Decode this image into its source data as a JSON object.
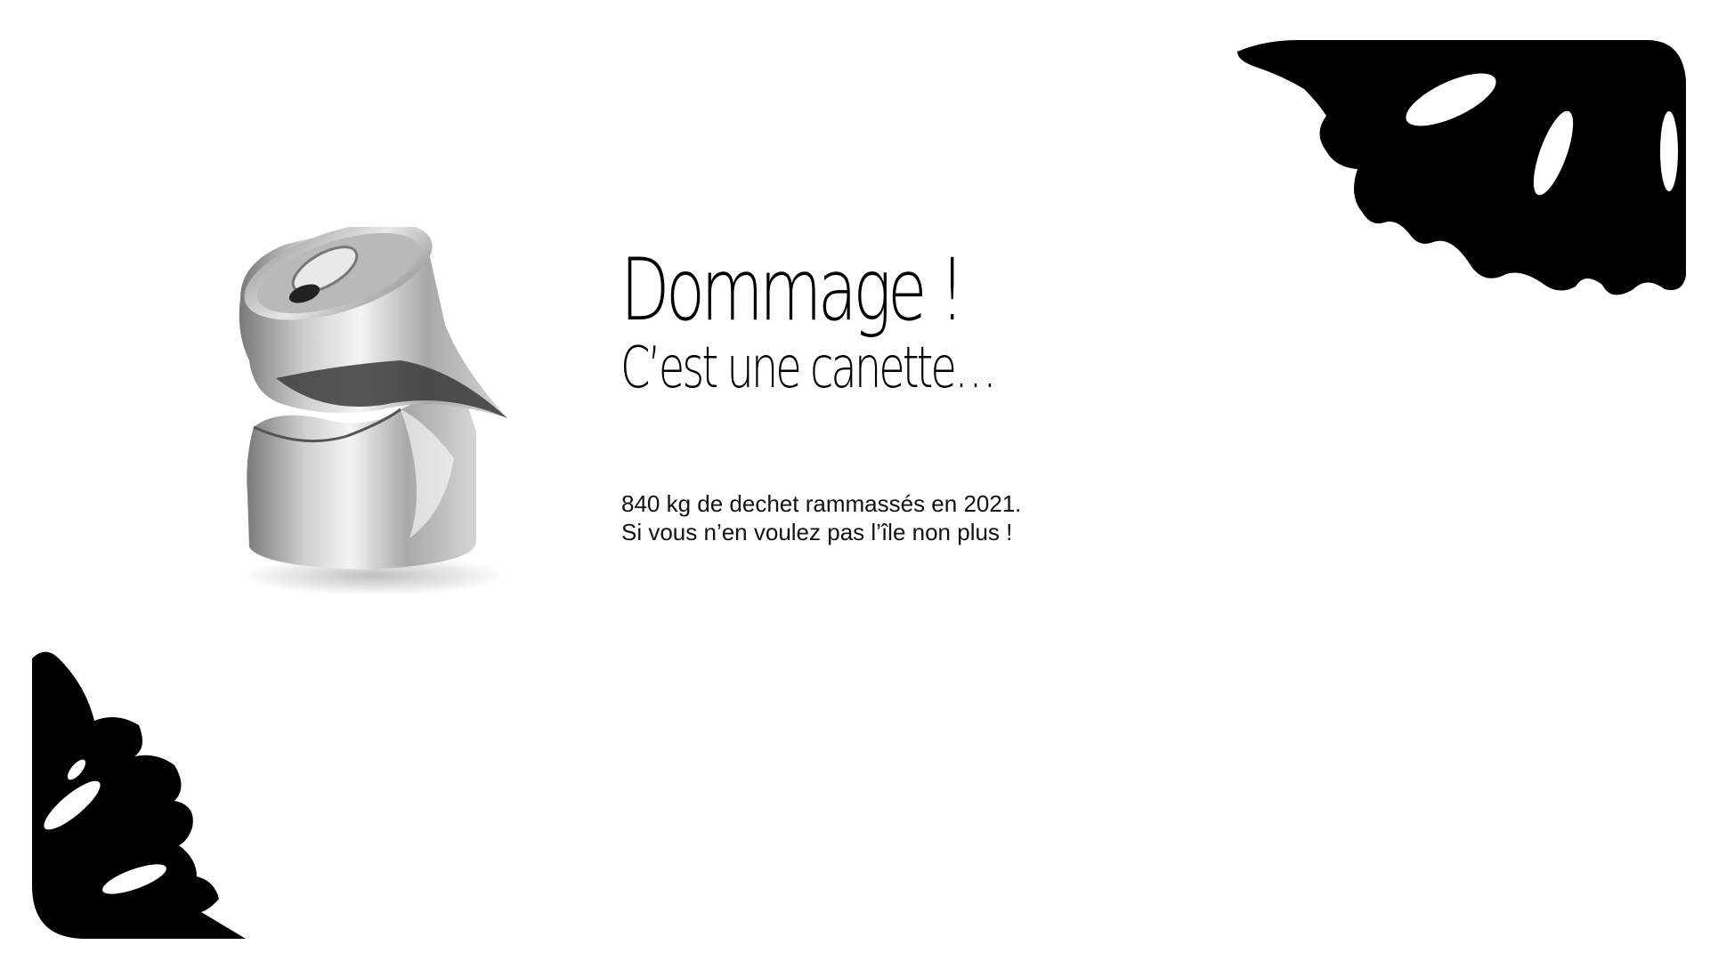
{
  "slide": {
    "title": "Dommage !",
    "subtitle": "C’est une canette…",
    "body_lines": [
      "840 kg de dechet rammassés en 2021.",
      "Si vous n’en voulez pas l’île non plus !"
    ]
  },
  "colors": {
    "background": "#ffffff",
    "corner_shapes": "#000000",
    "text": "#000000"
  },
  "icons": {
    "top_right": "leaf-corner-icon",
    "bottom_left": "leaf-corner-icon",
    "image": "crushed-can-illustration"
  }
}
